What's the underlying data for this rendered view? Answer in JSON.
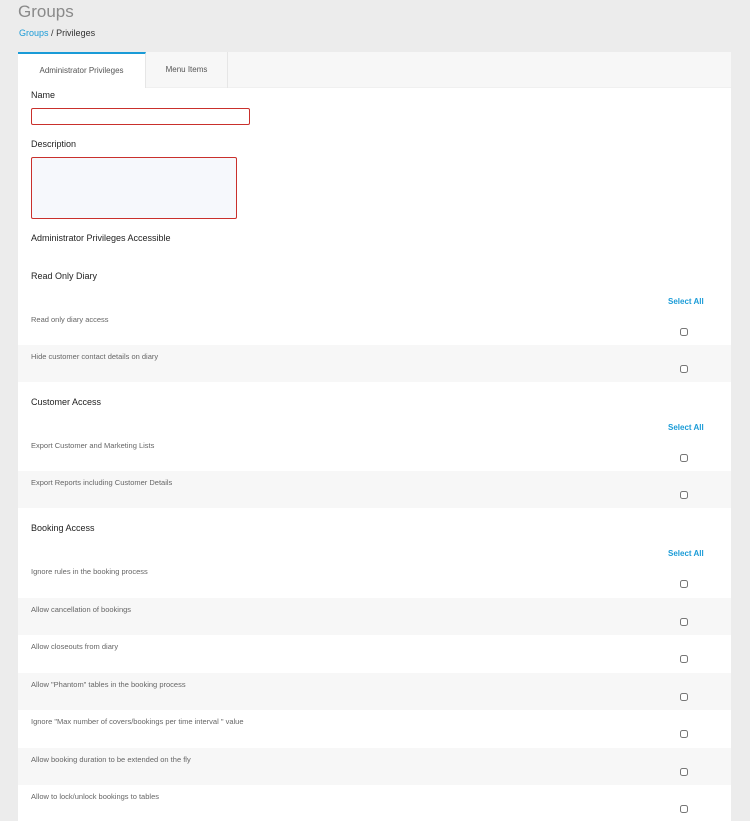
{
  "page": {
    "title": "Groups",
    "breadcrumb": {
      "link": "Groups",
      "separator": "/",
      "current": "Privileges"
    }
  },
  "colors": {
    "accent": "#1a9bd7",
    "error_border": "#c9302c",
    "background": "#ececec"
  },
  "tabs": [
    {
      "label": "Administrator Privileges",
      "active": true
    },
    {
      "label": "Menu Items",
      "active": false
    }
  ],
  "form": {
    "name_label": "Name",
    "name_value": "",
    "description_label": "Description",
    "description_value": "",
    "privileges_heading": "Administrator Privileges Accessible"
  },
  "sections": [
    {
      "title": "Read Only Diary",
      "select_all": "Select All",
      "items": [
        {
          "label": "Read only diary access",
          "checked": false
        },
        {
          "label": "Hide customer contact details on diary",
          "checked": false
        }
      ]
    },
    {
      "title": "Customer Access",
      "select_all": "Select All",
      "items": [
        {
          "label": "Export Customer and Marketing Lists",
          "checked": false
        },
        {
          "label": "Export Reports including Customer Details",
          "checked": false
        }
      ]
    },
    {
      "title": "Booking Access",
      "select_all": "Select All",
      "items": [
        {
          "label": "Ignore rules in the booking process",
          "checked": false
        },
        {
          "label": "Allow cancellation of bookings",
          "checked": false
        },
        {
          "label": "Allow closeouts from diary",
          "checked": false
        },
        {
          "label": "Allow \"Phantom\" tables in the booking process",
          "checked": false
        },
        {
          "label": "Ignore \"Max number of covers/bookings per time interval \" value",
          "checked": false
        },
        {
          "label": "Allow booking duration to be extended on the fly",
          "checked": false
        },
        {
          "label": "Allow to lock/unlock bookings to tables",
          "checked": false
        }
      ]
    }
  ]
}
